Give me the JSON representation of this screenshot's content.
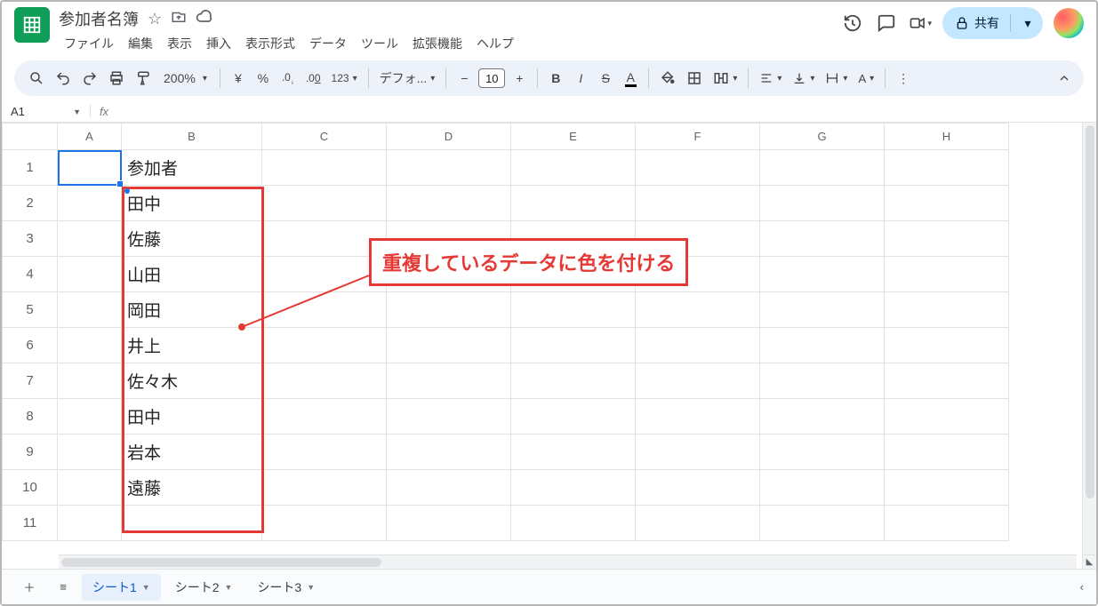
{
  "header": {
    "doc_title": "参加者名簿",
    "menus": [
      "ファイル",
      "編集",
      "表示",
      "挿入",
      "表示形式",
      "データ",
      "ツール",
      "拡張機能",
      "ヘルプ"
    ],
    "share_label": "共有"
  },
  "toolbar": {
    "zoom": "200%",
    "currency": "¥",
    "percent": "%",
    "dec_dec": ".0",
    "inc_dec": ".00",
    "numfmt": "123",
    "font": "デフォ...",
    "font_size": "10"
  },
  "namebox": {
    "ref": "A1"
  },
  "columns": [
    "A",
    "B",
    "C",
    "D",
    "E",
    "F",
    "G",
    "H"
  ],
  "rows": [
    "1",
    "2",
    "3",
    "4",
    "5",
    "6",
    "7",
    "8",
    "9",
    "10",
    "11"
  ],
  "cells": {
    "B1": "参加者",
    "B2": "田中",
    "B3": "佐藤",
    "B4": "山田",
    "B5": "岡田",
    "B6": "井上",
    "B7": "佐々木",
    "B8": "田中",
    "B9": "岩本",
    "B10": "遠藤"
  },
  "annotation": {
    "text": "重複しているデータに色を付ける"
  },
  "sheets": [
    {
      "name": "シート1",
      "active": true
    },
    {
      "name": "シート2",
      "active": false
    },
    {
      "name": "シート3",
      "active": false
    }
  ]
}
